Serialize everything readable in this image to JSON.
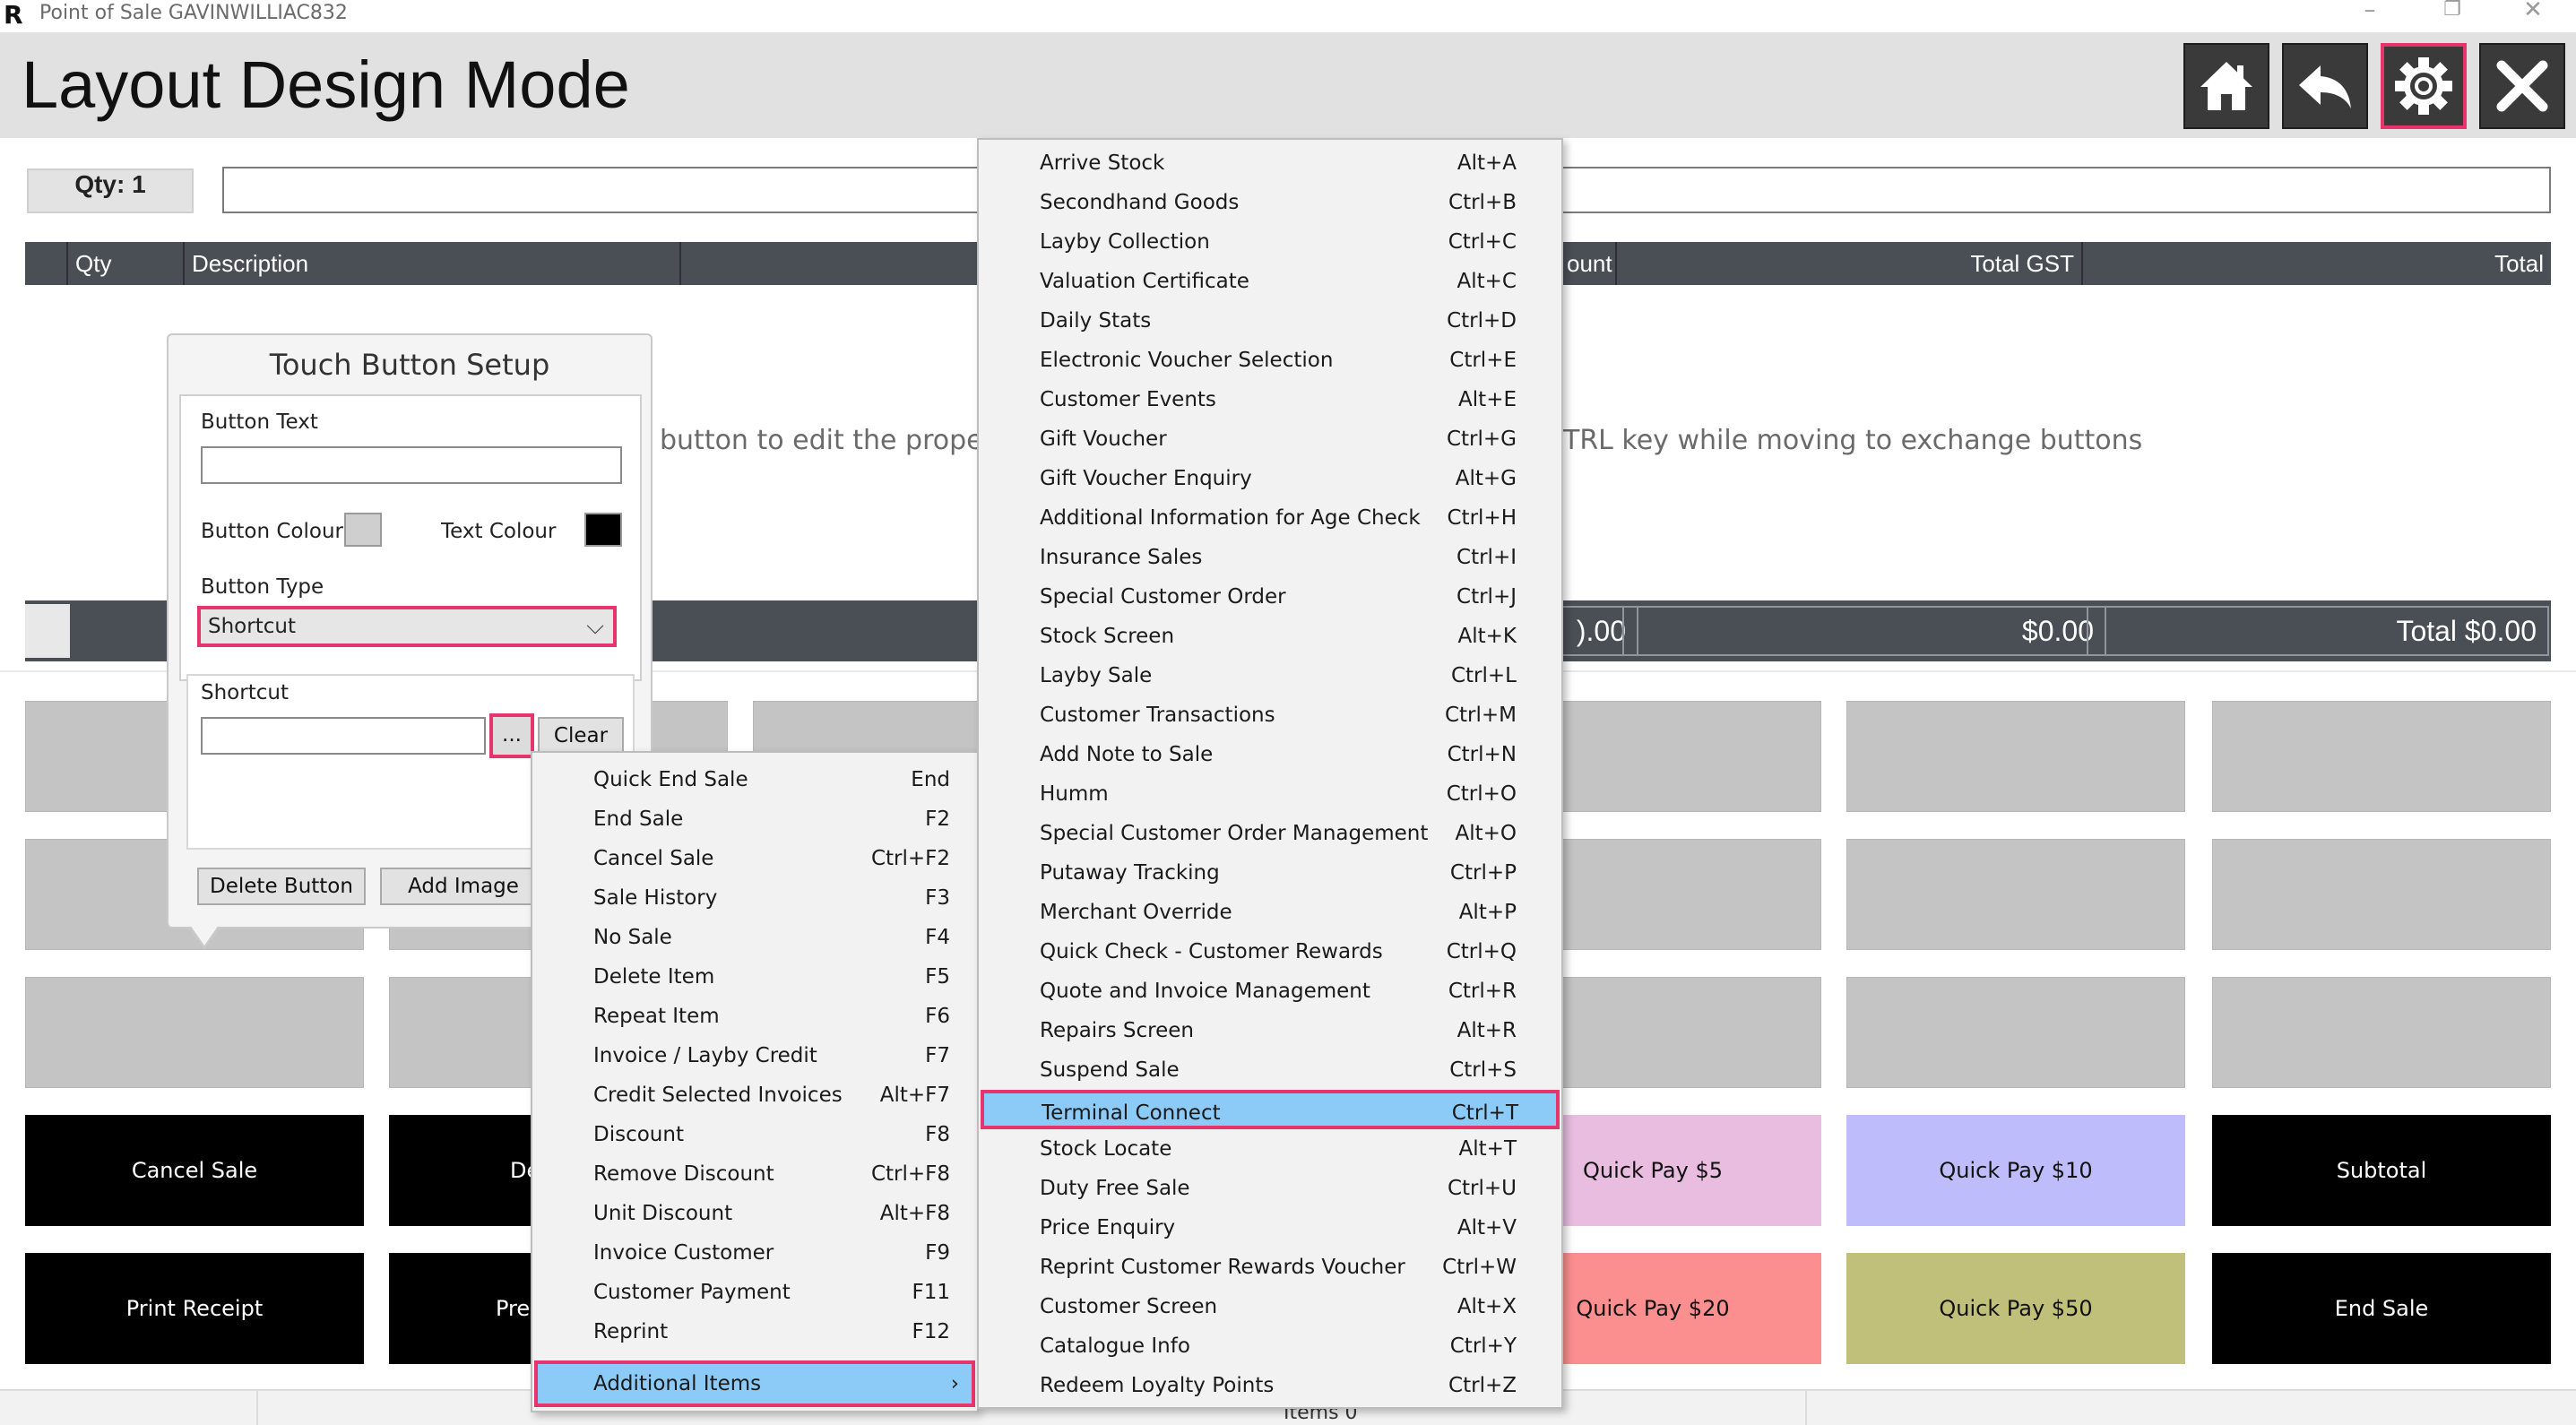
{
  "window": {
    "title": "Point of Sale GAVINWILLIAC832",
    "logo": "R",
    "controls": {
      "minimize": "–",
      "restore": "❐",
      "close": "✕"
    }
  },
  "header": {
    "title": "Layout Design Mode",
    "buttons": [
      {
        "name": "home-icon"
      },
      {
        "name": "back-arrow-icon"
      },
      {
        "name": "gear-icon",
        "active": true
      },
      {
        "name": "close-icon"
      }
    ]
  },
  "sale": {
    "qty_label": "Qty: 1",
    "scan_value": "",
    "columns": [
      "Qty",
      "Description",
      "ount",
      "Total GST",
      "Total"
    ],
    "hint_left": "button to edit the propert",
    "hint_right": "TRL key while moving to exchange buttons",
    "totals": {
      "partial": ").00",
      "gst": "$0.00",
      "total": "Total $0.00"
    }
  },
  "touch_buttons": {
    "cancel_sale": "Cancel Sale",
    "de_partial": "De",
    "print_receipt": "Print Receipt",
    "prev_partial": "Prev",
    "quick_pay_5": "Quick Pay $5",
    "quick_pay_10": "Quick Pay $10",
    "subtotal": "Subtotal",
    "quick_pay_20": "Quick Pay $20",
    "quick_pay_50": "Quick Pay $50",
    "end_sale": "End Sale"
  },
  "colors": {
    "accent": "#e6356d",
    "highlight": "#8ccaf7",
    "quick_pay_5": "#e8bde0",
    "quick_pay_10": "#bebcfb",
    "quick_pay_20": "#fb8f8f",
    "quick_pay_50": "#c0c07a"
  },
  "status": {
    "items": "Items 0"
  },
  "setup": {
    "title": "Touch Button Setup",
    "button_text_label": "Button Text",
    "button_text_value": "",
    "button_colour_label": "Button Colour",
    "text_colour_label": "Text Colour",
    "button_type_label": "Button Type",
    "button_type_value": "Shortcut",
    "shortcut_label": "Shortcut",
    "shortcut_value": "",
    "dots_label": "...",
    "clear_label": "Clear",
    "delete_label": "Delete Button",
    "add_image_label": "Add Image"
  },
  "menu1": {
    "items": [
      {
        "label": "Quick End Sale",
        "key": "End"
      },
      {
        "label": "End Sale",
        "key": "F2"
      },
      {
        "label": "Cancel Sale",
        "key": "Ctrl+F2"
      },
      {
        "label": "Sale History",
        "key": "F3"
      },
      {
        "label": "No Sale",
        "key": "F4"
      },
      {
        "label": "Delete Item",
        "key": "F5"
      },
      {
        "label": "Repeat Item",
        "key": "F6"
      },
      {
        "label": "Invoice / Layby Credit",
        "key": "F7"
      },
      {
        "label": "Credit Selected Invoices",
        "key": "Alt+F7"
      },
      {
        "label": "Discount",
        "key": "F8"
      },
      {
        "label": "Remove Discount",
        "key": "Ctrl+F8"
      },
      {
        "label": "Unit Discount",
        "key": "Alt+F8"
      },
      {
        "label": "Invoice Customer",
        "key": "F9"
      },
      {
        "label": "Customer Payment",
        "key": "F11"
      },
      {
        "label": "Reprint",
        "key": "F12"
      }
    ],
    "additional": {
      "label": "Additional Items",
      "arrow": "›"
    }
  },
  "menu2": {
    "items": [
      {
        "label": "Arrive Stock",
        "key": "Alt+A"
      },
      {
        "label": "Secondhand Goods",
        "key": "Ctrl+B"
      },
      {
        "label": "Layby Collection",
        "key": "Ctrl+C"
      },
      {
        "label": "Valuation Certificate",
        "key": "Alt+C"
      },
      {
        "label": "Daily Stats",
        "key": "Ctrl+D"
      },
      {
        "label": "Electronic Voucher Selection",
        "key": "Ctrl+E"
      },
      {
        "label": "Customer Events",
        "key": "Alt+E"
      },
      {
        "label": "Gift Voucher",
        "key": "Ctrl+G"
      },
      {
        "label": "Gift Voucher Enquiry",
        "key": "Alt+G"
      },
      {
        "label": "Additional Information for Age Check",
        "key": "Ctrl+H"
      },
      {
        "label": "Insurance Sales",
        "key": "Ctrl+I"
      },
      {
        "label": "Special Customer Order",
        "key": "Ctrl+J"
      },
      {
        "label": "Stock Screen",
        "key": "Alt+K"
      },
      {
        "label": "Layby Sale",
        "key": "Ctrl+L"
      },
      {
        "label": "Customer Transactions",
        "key": "Ctrl+M"
      },
      {
        "label": "Add Note to Sale",
        "key": "Ctrl+N"
      },
      {
        "label": "Humm",
        "key": "Ctrl+O"
      },
      {
        "label": "Special Customer Order Management",
        "key": "Alt+O"
      },
      {
        "label": "Putaway Tracking",
        "key": "Ctrl+P"
      },
      {
        "label": "Merchant Override",
        "key": "Alt+P"
      },
      {
        "label": "Quick Check - Customer Rewards",
        "key": "Ctrl+Q"
      },
      {
        "label": "Quote and Invoice Management",
        "key": "Ctrl+R"
      },
      {
        "label": "Repairs Screen",
        "key": "Alt+R"
      },
      {
        "label": "Suspend Sale",
        "key": "Ctrl+S"
      },
      {
        "label": "Terminal Connect",
        "key": "Ctrl+T",
        "highlighted": true
      },
      {
        "label": "Stock Locate",
        "key": "Alt+T"
      },
      {
        "label": "Duty Free Sale",
        "key": "Ctrl+U"
      },
      {
        "label": "Price Enquiry",
        "key": "Alt+V"
      },
      {
        "label": "Reprint Customer Rewards Voucher",
        "key": "Ctrl+W"
      },
      {
        "label": "Customer Screen",
        "key": "Alt+X"
      },
      {
        "label": "Catalogue Info",
        "key": "Ctrl+Y"
      },
      {
        "label": "Redeem Loyalty Points",
        "key": "Ctrl+Z"
      }
    ]
  }
}
